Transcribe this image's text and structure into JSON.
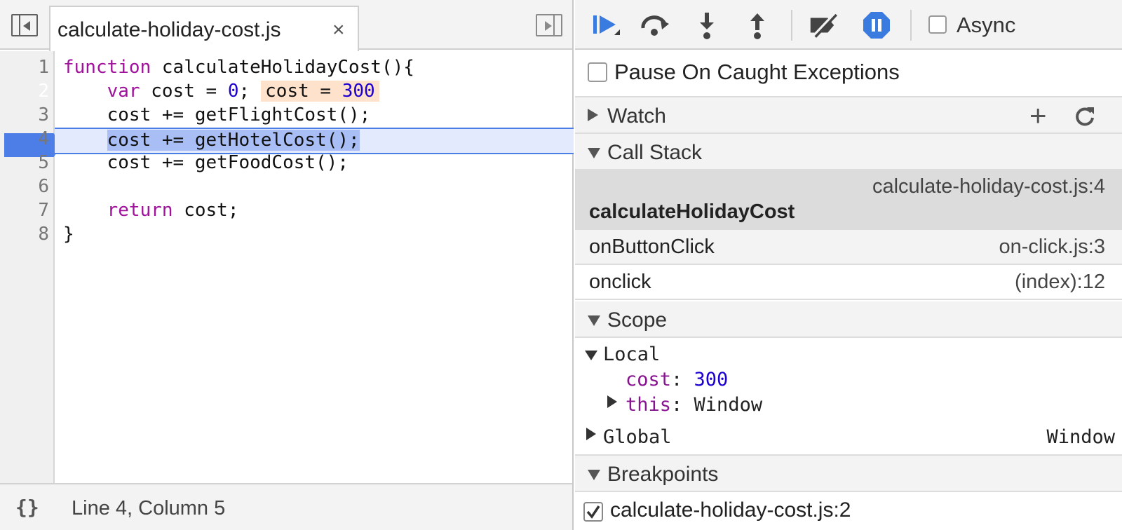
{
  "editor": {
    "tab_label": "calculate-holiday-cost.js",
    "tab_close": "×",
    "line_numbers": [
      "1",
      "2",
      "3",
      "4",
      "5",
      "6",
      "7",
      "8"
    ],
    "breakpoint_line": "2",
    "execution_line": "4",
    "code": {
      "l1_kw": "function",
      "l1_rest": " calculateHolidayCost(){",
      "l2_indent": "    ",
      "l2_kw": "var",
      "l2_mid": " cost = ",
      "l2_num": "0",
      "l2_end": ";",
      "l2_inline_name": "cost = ",
      "l2_inline_value": "300",
      "l3": "    cost += getFlightCost();",
      "l4_indent": "    ",
      "l4_sel": "cost += getHotelCost();",
      "l5": "    cost += getFoodCost();",
      "l7_indent": "    ",
      "l7_kw": "return",
      "l7_rest": " cost;",
      "l8": "}"
    }
  },
  "statusbar": {
    "pretty_print": "{}",
    "cursor_position": "Line 4, Column 5"
  },
  "debugger": {
    "async_label": "Async",
    "pause_on_caught_label": "Pause On Caught Exceptions",
    "watch": {
      "title": "Watch",
      "add": "+"
    },
    "call_stack": {
      "title": "Call Stack",
      "frames": [
        {
          "function": "calculateHolidayCost",
          "location": "calculate-holiday-cost.js:4"
        },
        {
          "function": "onButtonClick",
          "location": "on-click.js:3"
        },
        {
          "function": "onclick",
          "location": "(index):12"
        }
      ]
    },
    "scope": {
      "title": "Scope",
      "local_label": "Local",
      "vars": [
        {
          "name": "cost",
          "sep": ": ",
          "value": "300"
        },
        {
          "name": "this",
          "sep": ": ",
          "value": "Window"
        }
      ],
      "global_label": "Global",
      "global_value": "Window"
    },
    "breakpoints": {
      "title": "Breakpoints",
      "items": [
        {
          "label": "calculate-holiday-cost.js:2",
          "checked": true
        }
      ]
    }
  },
  "colors": {
    "accent": "#4d7ee8",
    "keyword": "#a0129b",
    "number": "#1c00cf",
    "execution_line_bg": "#e3eafd",
    "inline_value_bg": "#ffe2cc"
  }
}
